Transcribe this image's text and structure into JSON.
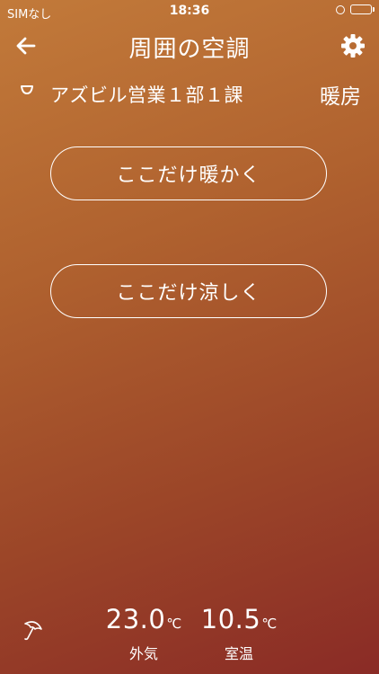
{
  "status_bar": {
    "carrier": "SIMなし",
    "time": "18:36"
  },
  "header": {
    "title": "周囲の空調",
    "back_icon": "arrow-left-icon",
    "settings_icon": "gear-icon"
  },
  "zone": {
    "name": "アズビル営業１部１課",
    "mode": "暖房"
  },
  "actions": {
    "warm_label": "ここだけ暖かく",
    "cool_label": "ここだけ涼しく"
  },
  "footer": {
    "outside": {
      "value": "23.0",
      "unit": "℃",
      "label": "外気"
    },
    "room": {
      "value": "10.5",
      "unit": "℃",
      "label": "室温"
    }
  },
  "colors": {
    "gradient_top": "#c27a3a",
    "gradient_bottom": "#8a2b26",
    "battery": "#4cd964"
  }
}
